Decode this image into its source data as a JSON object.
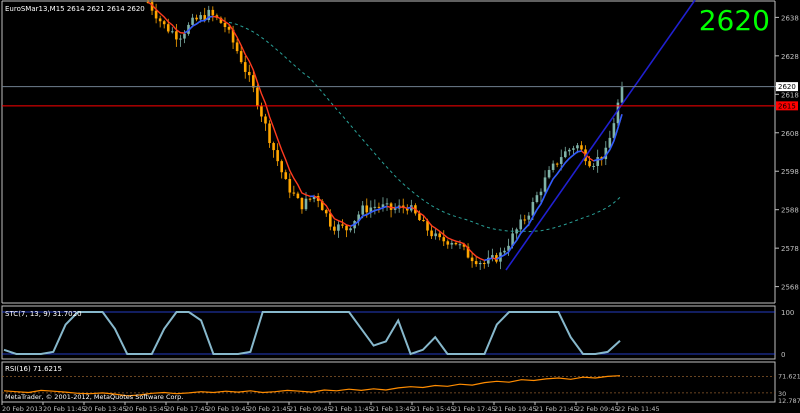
{
  "main_info": "EuroSMar13,M15  2614 2621 2614 2620",
  "big_price": "2620",
  "stc_label": "STC(7, 13, 9) 31.7020",
  "rsi_label": "RSI(16) 71.6215",
  "copyright": "MetaTrader, © 2001-2012, MetaQuotes Software Corp.",
  "colors": {
    "background": "#000000",
    "axis": "#c0c0c0",
    "big_price": "#00ff00",
    "bear_candle": "#ffa500",
    "bull_candle": "#7fb3a8",
    "fast_ma_red": "#ff3b1f",
    "fast_ma_blue": "#2b5cff",
    "slow_ma": "#2aa198",
    "trendline": "#2020d0",
    "hline_red": "#ff0000",
    "hline_gray": "#708090",
    "stc": "#87b8cc",
    "rsi": "#ff8c00"
  },
  "chart_data": [
    {
      "type": "candlestick",
      "title": "EuroSMar13,M15",
      "ylim": [
        2564,
        2642
      ],
      "price_ticks": [
        "2638",
        "2628",
        "2620",
        "2618",
        "2608",
        "2598",
        "2588",
        "2578",
        "2568"
      ],
      "price_tick_values": [
        2638,
        2628,
        2620,
        2618,
        2608,
        2598,
        2588,
        2578,
        2568
      ],
      "current_price": 2620,
      "red_level": 2615,
      "red_level_label": "2615",
      "close_path": [
        2642,
        2636,
        2633,
        2637,
        2639,
        2636,
        2628,
        2618,
        2606,
        2595,
        2589,
        2592,
        2584,
        2583,
        2588,
        2589,
        2588,
        2589,
        2584,
        2580,
        2580,
        2576,
        2574,
        2576,
        2582,
        2588,
        2596,
        2602,
        2605,
        2600,
        2603,
        2620
      ],
      "x_labels": [
        "20 Feb 2013",
        "20 Feb 11:45",
        "20 Feb 13:45",
        "20 Feb 15:45",
        "20 Feb 17:45",
        "20 Feb 19:45",
        "20 Feb 21:45",
        "21 Feb 09:45",
        "21 Feb 11:45",
        "21 Feb 13:45",
        "21 Feb 15:45",
        "21 Feb 17:45",
        "21 Feb 19:45",
        "21 Feb 21:45",
        "22 Feb 09:45",
        "22 Feb 11:45"
      ]
    },
    {
      "type": "line",
      "title": "STC(7, 13, 9) 31.7020",
      "ylim": [
        0,
        100
      ],
      "ticks": [
        "100",
        "0"
      ],
      "tick_values": [
        100,
        0
      ],
      "values": [
        10,
        0,
        0,
        0,
        5,
        70,
        100,
        100,
        100,
        60,
        0,
        0,
        0,
        60,
        100,
        100,
        80,
        0,
        0,
        0,
        5,
        100,
        100,
        100,
        100,
        100,
        100,
        100,
        100,
        60,
        20,
        30,
        80,
        0,
        10,
        40,
        0,
        0,
        0,
        0,
        70,
        100,
        100,
        100,
        100,
        100,
        40,
        0,
        0,
        5,
        31.702
      ]
    },
    {
      "type": "line",
      "title": "RSI(16) 71.6215",
      "ylim": [
        12.7873,
        100
      ],
      "ticks": [
        "71.6215",
        "30",
        "12.7873"
      ],
      "tick_values": [
        71.6215,
        30,
        12.7873
      ],
      "levels": [
        70,
        30
      ],
      "values": [
        35,
        33,
        31,
        36,
        34,
        32,
        29,
        28,
        30,
        27,
        23,
        25,
        29,
        31,
        28,
        30,
        33,
        31,
        34,
        32,
        35,
        31,
        33,
        36,
        34,
        32,
        37,
        35,
        39,
        36,
        40,
        37,
        42,
        45,
        43,
        48,
        46,
        51,
        49,
        55,
        58,
        56,
        62,
        60,
        64,
        66,
        63,
        68,
        66,
        70,
        71.6215
      ]
    }
  ]
}
